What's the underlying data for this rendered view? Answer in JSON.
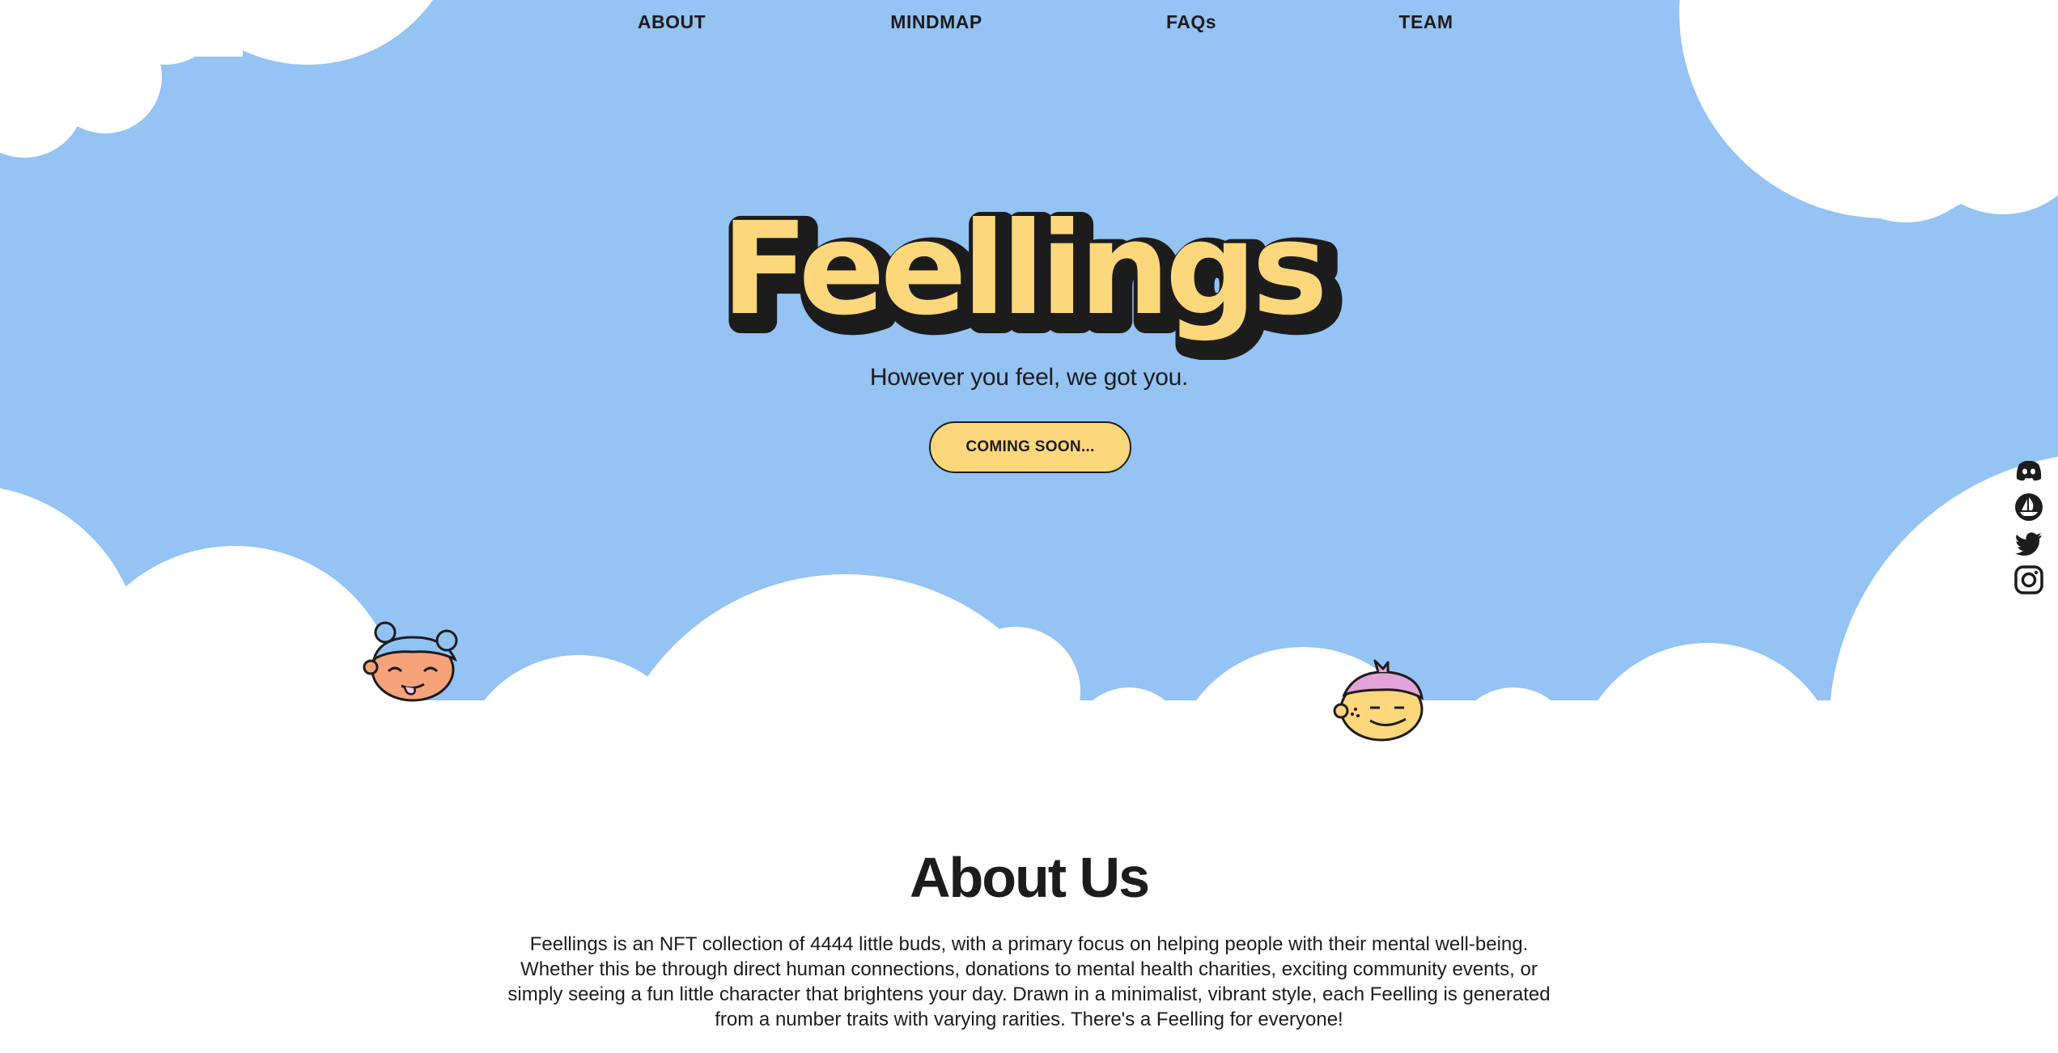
{
  "nav": {
    "items": [
      {
        "label": "ABOUT"
      },
      {
        "label": "MINDMAP"
      },
      {
        "label": "FAQs"
      },
      {
        "label": "TEAM"
      }
    ]
  },
  "hero": {
    "title": "Feellings",
    "tagline": "However you feel, we got you.",
    "cta_label": "COMING SOON..."
  },
  "social": {
    "items": [
      {
        "icon": "discord-icon"
      },
      {
        "icon": "opensea-icon"
      },
      {
        "icon": "twitter-icon"
      },
      {
        "icon": "instagram-icon"
      }
    ]
  },
  "about": {
    "title": "About Us",
    "body": "Feellings is an NFT collection of 4444 little buds, with a primary focus on helping people with their mental well-being. Whether this be through direct human connections, donations to mental health charities, exciting community events, or simply seeing a fun little character that brightens your day. Drawn in a minimalist, vibrant style, each Feelling is generated from a number traits with varying rarities. There's a Feelling for everyone!"
  },
  "colors": {
    "sky": "#94c3f4",
    "cloud": "#ffffff",
    "brand_yellow": "#fdd77b",
    "ink": "#1c1c1c",
    "char1_face": "#f6a37b",
    "char1_hair": "#8fc3f4",
    "char2_face": "#fdd77b",
    "char2_hair": "#e4a3d8"
  }
}
